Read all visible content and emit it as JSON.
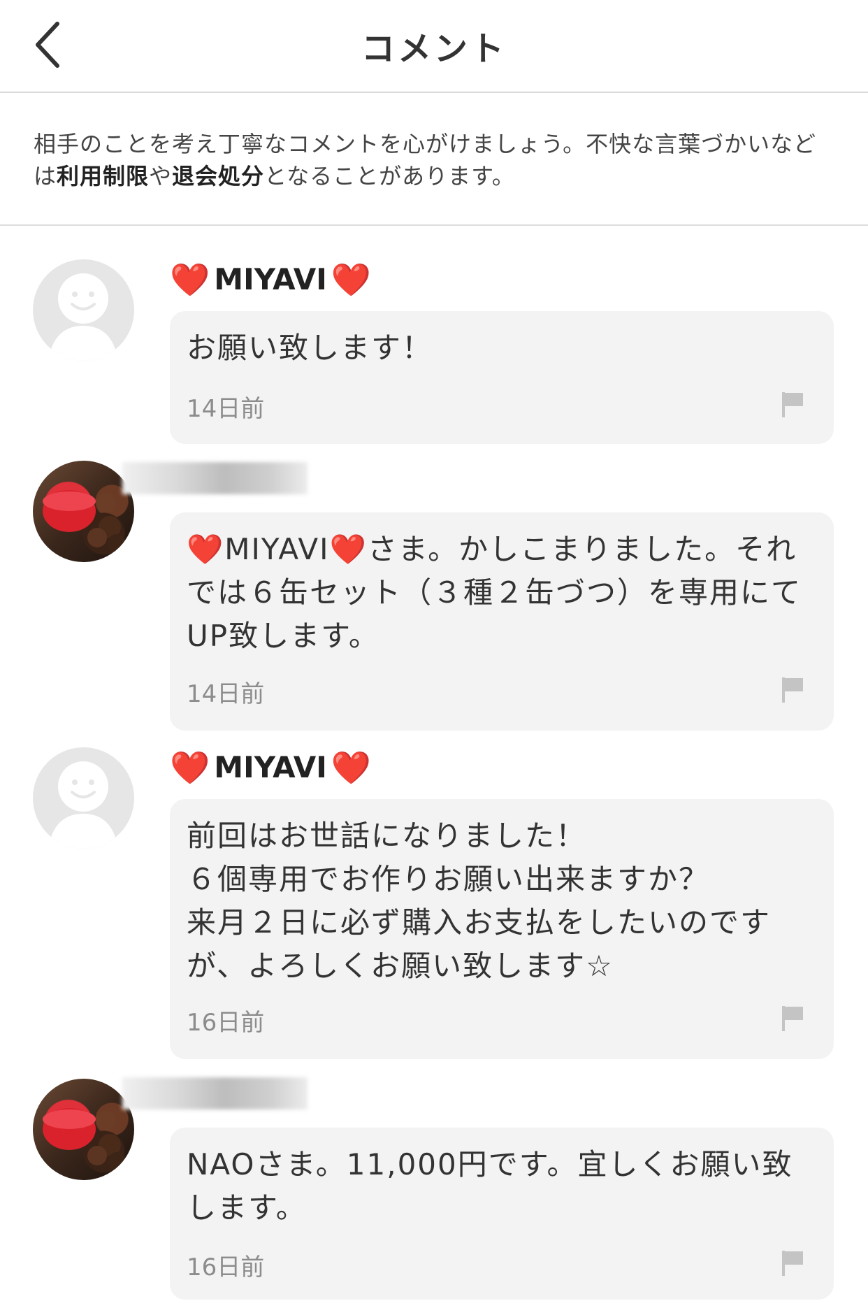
{
  "header": {
    "title": "コメント",
    "back_icon": "chevron-left-icon"
  },
  "notice": {
    "part1": "相手のことを考え丁寧なコメントを心がけましょう。不快な言葉づかいなどは",
    "bold1": "利用制限",
    "part2": "や",
    "bold2": "退会処分",
    "part3": "となることがあります。"
  },
  "comments": [
    {
      "avatar": "default-user-icon",
      "heart_left": "❤️",
      "name": "MIYAVI",
      "heart_right": "❤️",
      "text": "お願い致します！",
      "time": "14日前",
      "flag_icon": "flag-icon"
    },
    {
      "avatar": "cake-photo",
      "name_hidden": true,
      "text": "❤️MIYAVI❤️さま。かしこまりました。それでは６缶セット（３種２缶づつ）を専用にてUP致します。",
      "time": "14日前",
      "flag_icon": "flag-icon"
    },
    {
      "avatar": "default-user-icon",
      "heart_left": "❤️",
      "name": "MIYAVI",
      "heart_right": "❤️",
      "text": "前回はお世話になりました！\n６個専用でお作りお願い出来ますか？\n来月２日に必ず購入お支払をしたいのですが、よろしくお願い致します☆",
      "time": "16日前",
      "flag_icon": "flag-icon"
    },
    {
      "avatar": "cake-photo",
      "name_hidden": true,
      "text": "NAOさま。11,000円です。宜しくお願い致します。",
      "time": "16日前",
      "flag_icon": "flag-icon"
    }
  ],
  "colors": {
    "heart": "#e8192c",
    "bubble_bg": "#f3f3f3",
    "time_text": "#8c8c8c"
  }
}
